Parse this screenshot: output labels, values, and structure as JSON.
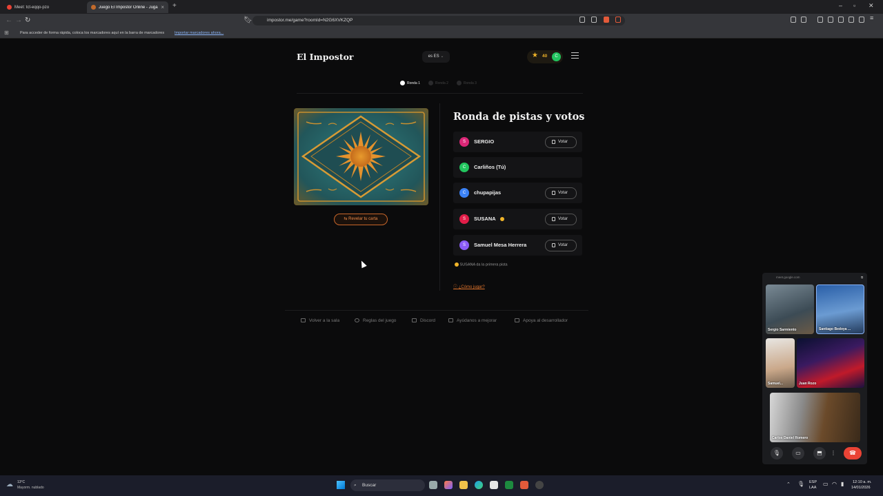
{
  "browser": {
    "tabs": [
      {
        "title": "Meet: tct-eqqo-pzo"
      },
      {
        "title": "Juego El Impostor Online - Jugar"
      }
    ],
    "url": "impostor.me/game?roomId=N2G6XVKZQP",
    "bookmark_hint": "Para acceder de forma rápida, coloca los marcadores aquí en la barra de marcadores",
    "bookmark_link": "Importar marcadores ahora..."
  },
  "header": {
    "title": "El Impostor",
    "lang": "ES",
    "lang_prefix": "es",
    "points": "40",
    "avatar_letter": "C"
  },
  "rounds": [
    {
      "label": "Ronda 1",
      "active": true
    },
    {
      "label": "Ronda 2",
      "active": false
    },
    {
      "label": "Ronda 3",
      "active": false
    }
  ],
  "card": {
    "reveal_label": "Revelar tu carta"
  },
  "panel": {
    "title": "Ronda de pistas y votos",
    "vote_label": "Votar",
    "players": [
      {
        "initial": "S",
        "name": "SERGIO",
        "color": "#db2777",
        "can_vote": true
      },
      {
        "initial": "C",
        "name": "Carliños (Tú)",
        "color": "#22c55e",
        "can_vote": false
      },
      {
        "initial": "C",
        "name": "chupapijas",
        "color": "#3b82f6",
        "can_vote": true
      },
      {
        "initial": "S",
        "name": "SUSANA",
        "color": "#e11d48",
        "can_vote": true,
        "coin": true
      },
      {
        "initial": "S",
        "name": "Samuel Mesa Herrera",
        "color": "#8b5cf6",
        "can_vote": true
      }
    ],
    "hint": "SUSANA da la primera pista",
    "how_to": "¿Cómo jugar?"
  },
  "footer": {
    "links": [
      "Volver a la sala",
      "Reglas del juego",
      "Discord",
      "Ayúdanos a mejorar",
      "Apoya al desarrollador"
    ]
  },
  "meet": {
    "source": "meet.google.com",
    "participants": [
      "Sergio Sarmiento",
      "Santiago Bedoya ...",
      "Samuel...",
      "Juan Rozo",
      "Carlos Daniel Romero"
    ]
  },
  "taskbar": {
    "temp": "13°C",
    "weather": "Mayorm. nublado",
    "search": "Buscar",
    "lang1": "ESP",
    "lang2": "LAA",
    "time": "12:10 a. m.",
    "date": "14/01/2026"
  },
  "colors": {
    "accent": "#e0742c",
    "gold": "#f0b429",
    "bg": "#0b0b0c"
  }
}
